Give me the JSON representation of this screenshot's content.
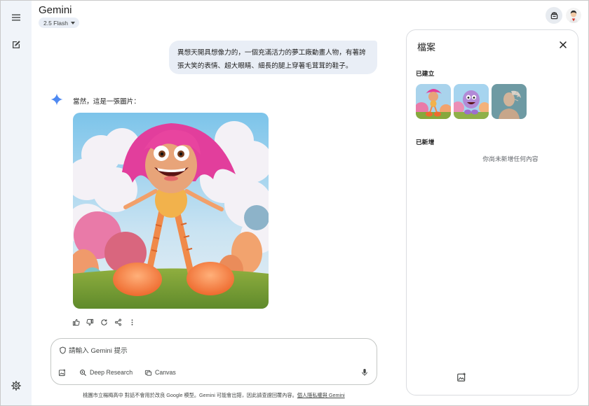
{
  "app": {
    "title": "Gemini",
    "model_label": "2.5 Flash"
  },
  "chat": {
    "user_message_line1": "異想天開具想像力的，一個充滿活力的夢工廠動畫人物，有著誇",
    "user_message_line2": "張大笑的表情、超大眼睛、細長的腿上穿著毛茸茸的鞋子。",
    "assistant_reply": "當然，這是一張圖片："
  },
  "input": {
    "placeholder": "請輸入 Gemini 提示",
    "value": "",
    "tools": {
      "deep_research": "Deep Research",
      "canvas": "Canvas"
    }
  },
  "footer": {
    "disclaimer": "桃園市立楊梅高中 對話不會用於改良 Google 模型。Gemini 可能會出錯，因此請查證回覆內容。",
    "privacy_link": "個人隱私權與 Gemini"
  },
  "files_panel": {
    "title": "檔案",
    "created_label": "已建立",
    "added_label": "已新增",
    "empty_message": "你尚未新增任何內容"
  },
  "colors": {
    "rail_bg": "#f0f4f9",
    "bubble_bg": "#e9eef6",
    "gemini_blue": "#4285f4",
    "text_primary": "#1f1f1f",
    "text_secondary": "#444746"
  },
  "icons": {
    "menu": "menu-icon",
    "new_chat": "edit-icon",
    "settings": "gear-icon",
    "files": "files-icon",
    "spark": "gemini-spark-icon",
    "thumb_up": "thumb-up-icon",
    "thumb_down": "thumb-down-icon",
    "regenerate": "refresh-icon",
    "share": "share-icon",
    "more": "more-vert-icon",
    "shield": "shield-icon",
    "add_image": "add-image-icon",
    "deep_research": "deep-research-icon",
    "canvas": "canvas-icon",
    "mic": "mic-icon",
    "close": "close-icon"
  }
}
